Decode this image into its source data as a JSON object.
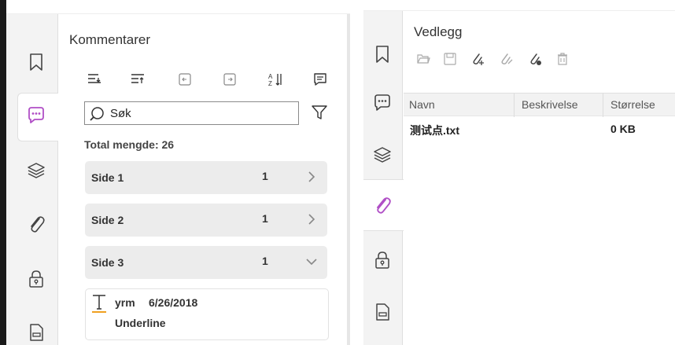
{
  "comments_panel": {
    "title": "Kommentarer",
    "search": {
      "placeholder": "Søk",
      "value": ""
    },
    "total_label": "Total mengde: 26",
    "pages": [
      {
        "label": "Side 1",
        "count": "1",
        "state": "collapsed"
      },
      {
        "label": "Side 2",
        "count": "1",
        "state": "collapsed"
      },
      {
        "label": "Side 3",
        "count": "1",
        "state": "expanded"
      }
    ],
    "annotation": {
      "author": "yrm",
      "date": "6/26/2018",
      "type": "Underline"
    },
    "accent_color": "#f0a020"
  },
  "attachments_panel": {
    "title": "Vedlegg",
    "columns": [
      "Navn",
      "Beskrivelse",
      "Størrelse"
    ],
    "rows": [
      {
        "name": "测试点.txt",
        "description": "",
        "size": "0 KB"
      }
    ],
    "accent_color": "#b04fc6"
  },
  "icons": {
    "left_rail": [
      "bookmark-icon",
      "comment-icon",
      "layers-icon",
      "attachment-icon",
      "lock-icon",
      "document-icon"
    ],
    "comment_toolbar": [
      "expand-all-icon",
      "collapse-all-icon",
      "previous-icon",
      "next-icon",
      "sort-icon",
      "add-comment-icon"
    ],
    "attachment_toolbar": [
      "open-folder-icon",
      "save-icon",
      "add-attachment-icon",
      "edit-attachment-icon",
      "attachment-properties-icon",
      "delete-icon"
    ]
  }
}
